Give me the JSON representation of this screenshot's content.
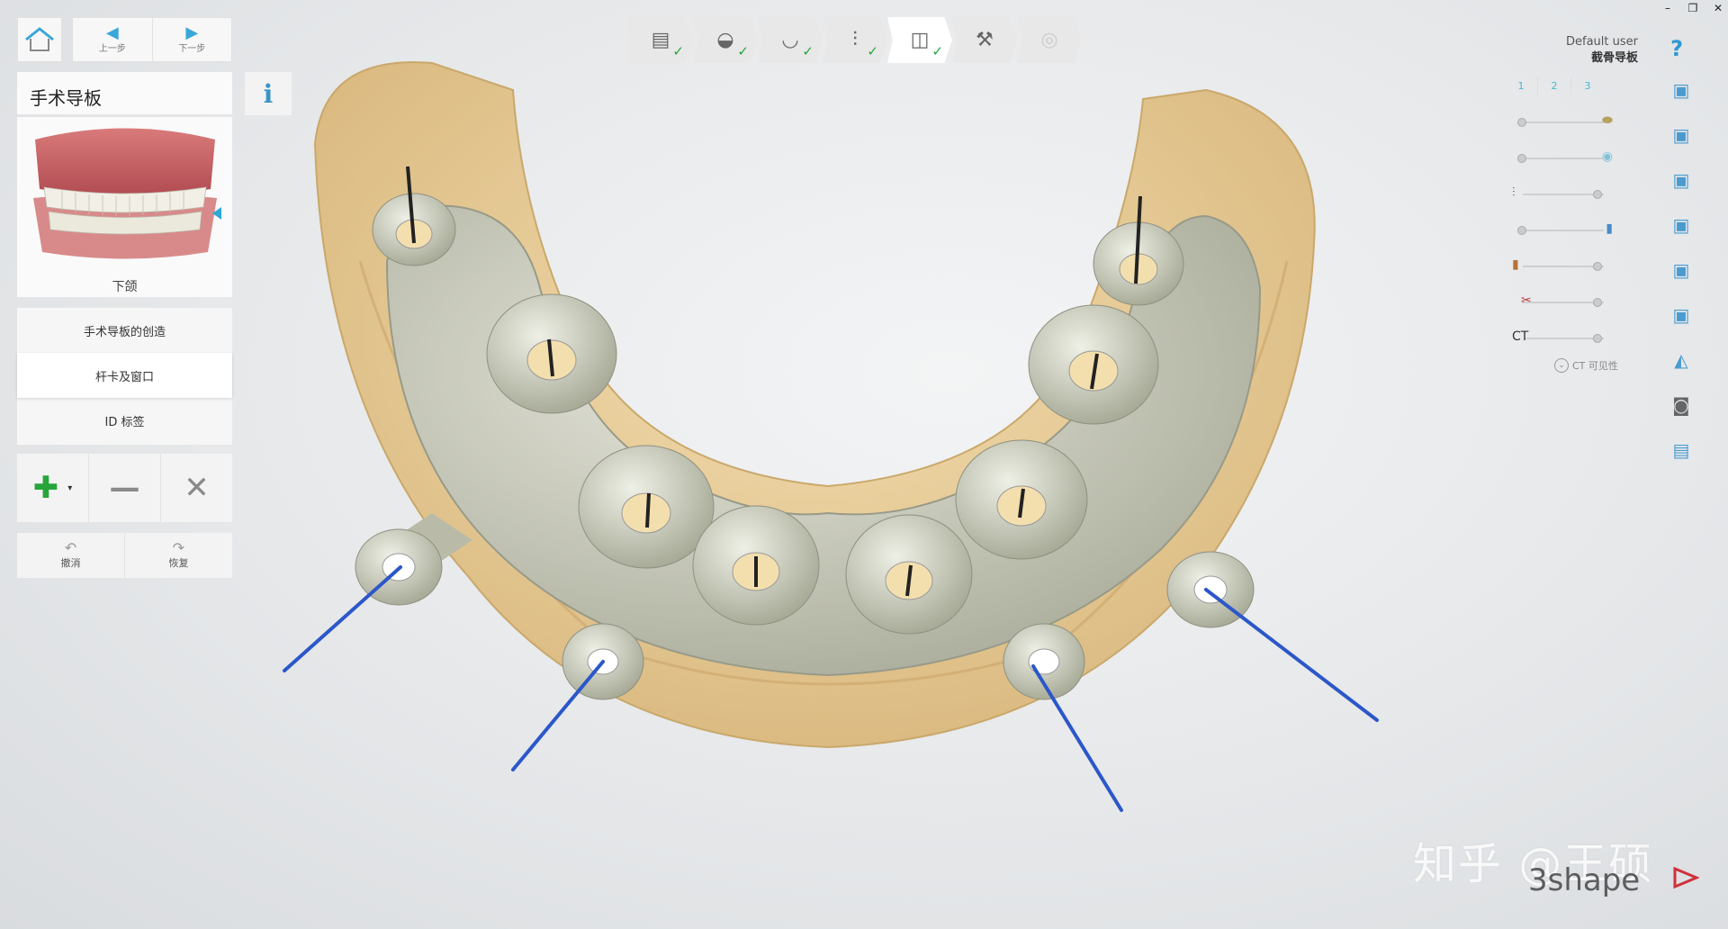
{
  "nav": {
    "prev_label": "上一步",
    "next_label": "下一步"
  },
  "panel": {
    "title": "手术导板",
    "jaw_label": "下颌",
    "steps": [
      "手术导板的创造",
      "杆卡及窗口",
      "ID 标签"
    ],
    "active_step": "杆卡及窗口"
  },
  "undo": {
    "undo_label": "撤消",
    "redo_label": "恢复"
  },
  "user": {
    "name": "Default user",
    "context": "截骨导板"
  },
  "layers": {
    "tabs": [
      "1",
      "2",
      "3"
    ],
    "ct_label": "CT",
    "ct_visible_label": "CT 可见性"
  },
  "watermark": {
    "text": "知乎 @王硕",
    "brand": "3shape"
  },
  "colors": {
    "accent": "#2f98cf",
    "check": "#27a53a",
    "guide": "#c9cbbb",
    "bone": "#e8c98e",
    "pin": "#2b57c9"
  },
  "icons": {
    "home": "home-icon",
    "info": "info-icon",
    "add": "add-icon",
    "remove": "minus-icon",
    "delete": "close-icon",
    "help": "help-icon"
  }
}
